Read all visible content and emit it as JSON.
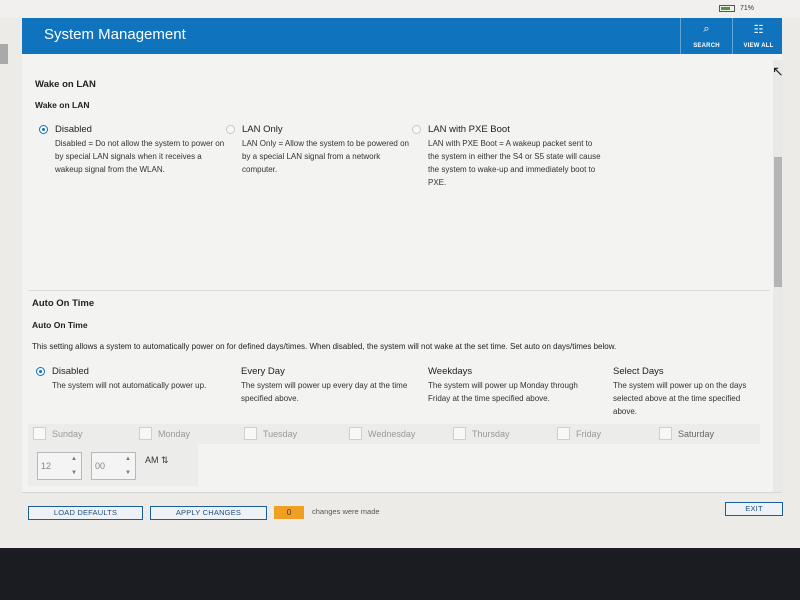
{
  "status": {
    "battery": "71%"
  },
  "app": {
    "title": "System Management",
    "search_label": "SEARCH",
    "viewall_label": "VIEW ALL",
    "accent": "#0f73be"
  },
  "wake_on_lan": {
    "section_title": "Wake on LAN",
    "subtitle": "Wake on LAN",
    "selected": "Disabled",
    "options": [
      {
        "title": "Disabled",
        "desc": "Disabled = Do not allow the system to power on by special LAN signals when it receives a wakeup signal from the WLAN."
      },
      {
        "title": "LAN Only",
        "desc": "LAN Only = Allow the system to be powered on by a special LAN signal from a network computer."
      },
      {
        "title": "LAN with PXE Boot",
        "desc": "LAN with PXE Boot = A wakeup packet sent to the system in either the S4 or S5 state will cause the system to wake-up and immediately boot to PXE."
      }
    ]
  },
  "auto_on_time": {
    "section_title": "Auto On Time",
    "subtitle": "Auto On Time",
    "note": "This setting allows a system to automatically power on for defined days/times. When disabled, the system will not wake at the set time. Set auto on days/times below.",
    "selected": "Disabled",
    "options": [
      {
        "title": "Disabled",
        "desc": "The system will not automatically power up."
      },
      {
        "title": "Every Day",
        "desc": "The system will power up every day at the time specified above."
      },
      {
        "title": "Weekdays",
        "desc": "The system will power up Monday through Friday at the time specified above."
      },
      {
        "title": "Select Days",
        "desc": "The system will power up on the days selected above at the time specified above."
      }
    ],
    "days": [
      "Sunday",
      "Monday",
      "Tuesday",
      "Wednesday",
      "Thursday",
      "Friday",
      "Saturday"
    ],
    "hour": "12",
    "minute": "00",
    "ampm": "AM ⇅"
  },
  "footer": {
    "load_defaults": "LOAD DEFAULTS",
    "apply_changes": "APPLY CHANGES",
    "changes_count": "0",
    "changes_text": "changes were made",
    "exit": "EXIT"
  }
}
